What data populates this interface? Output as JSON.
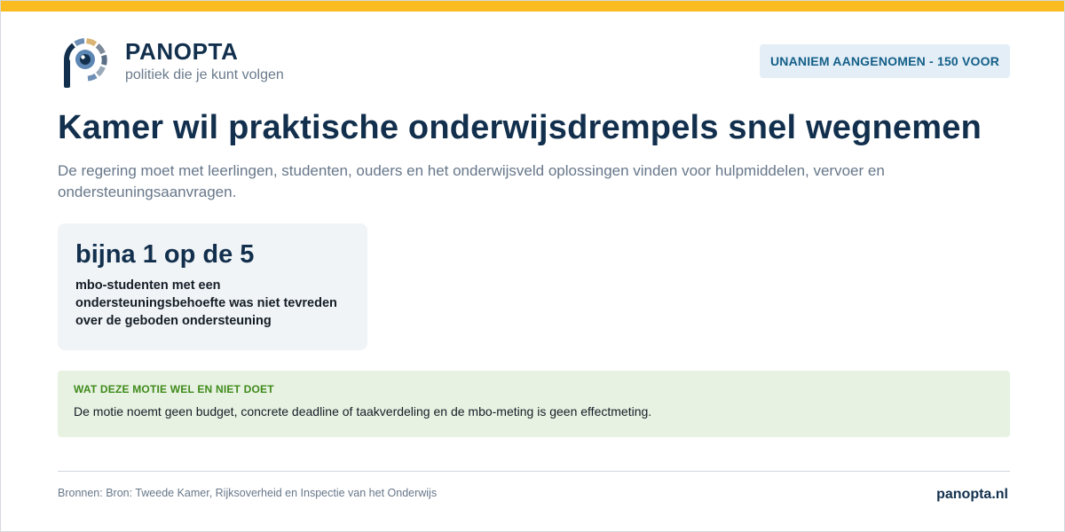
{
  "header": {
    "brand_name": "PANOPTA",
    "tagline": "politiek die je kunt volgen",
    "status_badge": "UNANIEM AANGENOMEN - 150 VOOR",
    "logo_icon": "eye-logo-icon"
  },
  "article": {
    "headline": "Kamer wil praktische onderwijsdrempels snel wegnemen",
    "subline": "De regering moet met leerlingen, studenten, ouders en het onderwijsveld oplossingen vinden voor hulpmiddelen, vervoer en ondersteuningsaanvragen."
  },
  "stat": {
    "value": "bijna 1 op de 5",
    "description": "mbo-studenten met een ondersteuningsbehoefte was niet tevreden over de geboden ondersteuning"
  },
  "note": {
    "title": "WAT DEZE MOTIE WEL EN NIET DOET",
    "text": "De motie noemt geen budget, concrete deadline of taakverdeling en de mbo-meting is geen effectmeting."
  },
  "footer": {
    "sources": "Bronnen: Bron: Tweede Kamer, Rijksoverheid en Inspectie van het Onderwijs",
    "site_link": "panopta.nl"
  },
  "colors": {
    "accent_bar": "#fbbc22",
    "primary_text": "#12304d",
    "badge_bg": "#e3eef7",
    "badge_text": "#135f88",
    "note_bg": "#e7f2e2",
    "note_title": "#3f8a1b"
  }
}
